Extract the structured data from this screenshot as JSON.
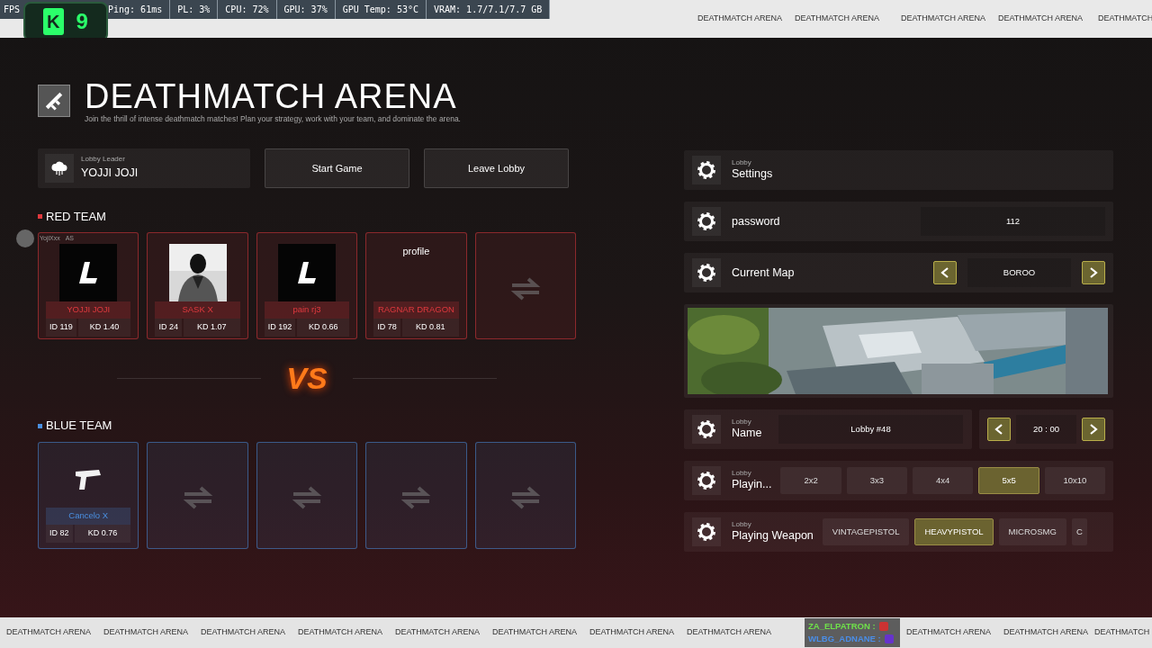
{
  "stats_overlay": {
    "logo": [
      "K",
      "9"
    ],
    "items": [
      "FPS",
      "Ping: 61ms",
      "PL: 3%",
      "CPU: 72%",
      "GPU: 37%",
      "GPU Temp: 53°C",
      "VRAM: 1.7/7.1/7.7 GB"
    ]
  },
  "top_ticker": [
    "DEATHMATCH ARENA",
    "DEATHMATCH ARENA",
    "DEATHMATCH ARENA",
    "DEATHMATCH ARENA",
    "DEATHMATCH"
  ],
  "header": {
    "title": "DEATHMATCH ARENA",
    "subtitle": "Join the thrill of intense deathmatch matches! Plan your strategy, work with your team, and dominate the arena."
  },
  "lobby_leader": {
    "label": "Lobby Leader",
    "name": "YOJJI JOJI"
  },
  "actions": [
    "Start Game",
    "Leave Lobby"
  ],
  "voice_overlay": {
    "name": "YojiXxx",
    "tag": "AS"
  },
  "teams": [
    {
      "name": "RED TEAM",
      "color": "#e0393e",
      "slots": [
        {
          "kind": "player",
          "avatar": {
            "kind": "logo"
          },
          "name": "YOJJI JOJI",
          "id": "ID 119",
          "kd": "KD 1.40"
        },
        {
          "kind": "player",
          "avatar": {
            "kind": "picture"
          },
          "name": "SASK X",
          "id": "ID 24",
          "kd": "KD 1.07"
        },
        {
          "kind": "player",
          "avatar": {
            "kind": "logo"
          },
          "name": "pain rj3",
          "id": "ID 192",
          "kd": "KD 0.66"
        },
        {
          "kind": "player",
          "avatar": {
            "kind": "broken",
            "alt": "profile"
          },
          "name": "RAGNAR DRAGON",
          "id": "ID 78",
          "kd": "KD 0.81"
        },
        {
          "kind": "empty"
        }
      ]
    },
    {
      "name": "BLUE TEAM",
      "color": "#4a8fe0",
      "slots": [
        {
          "kind": "player",
          "avatar": {
            "kind": "pistol"
          },
          "name": "Cancelo X",
          "id": "ID 82",
          "kd": "KD 0.76"
        },
        {
          "kind": "empty"
        },
        {
          "kind": "empty"
        },
        {
          "kind": "empty"
        },
        {
          "kind": "empty"
        }
      ]
    }
  ],
  "vs_text": "VS",
  "settings": [
    {
      "kind": "header",
      "label": "Lobby",
      "title": "Settings"
    },
    {
      "kind": "text",
      "title": "password",
      "value": "112"
    },
    {
      "kind": "selector",
      "title": "Current Map",
      "value": "BOROO"
    },
    {
      "kind": "picture"
    },
    {
      "kind": "name_time",
      "label": "Lobby",
      "title": "Name",
      "value": "Lobby #48",
      "time": "20 : 00"
    },
    {
      "kind": "options",
      "label": "Lobby",
      "title": "Playin...",
      "options": [
        {
          "text": "2x2",
          "selected": false
        },
        {
          "text": "3x3",
          "selected": false
        },
        {
          "text": "4x4",
          "selected": false
        },
        {
          "text": "5x5",
          "selected": true
        },
        {
          "text": "10x10",
          "selected": false
        }
      ]
    },
    {
      "kind": "options",
      "label": "Lobby",
      "title": "Playing Weapon",
      "options": [
        {
          "text": "VINTAGEPISTOL",
          "selected": false
        },
        {
          "text": "HEAVYPISTOL",
          "selected": true
        },
        {
          "text": "MICROSMG",
          "selected": false
        },
        {
          "text": "C",
          "selected": false
        }
      ]
    }
  ],
  "bottom_ticker": [
    "DEATHMATCH ARENA",
    "DEATHMATCH ARENA",
    "DEATHMATCH ARENA",
    "DEATHMATCH ARENA",
    "DEATHMATCH ARENA",
    "DEATHMATCH ARENA",
    "DEATHMATCH ARENA",
    "DEATHMATCH ARENA"
  ],
  "chat_overlay": [
    {
      "name": "ZA_ELPATRON :",
      "color": "#6fe04a"
    },
    {
      "name": "WLBG_ADNANE :",
      "color": "#4a8ee8"
    }
  ],
  "bottom_ticker_end": [
    "DEATHMATCH ARENA",
    "DEATHMATCH ARENA",
    "DEATHMATCH"
  ]
}
